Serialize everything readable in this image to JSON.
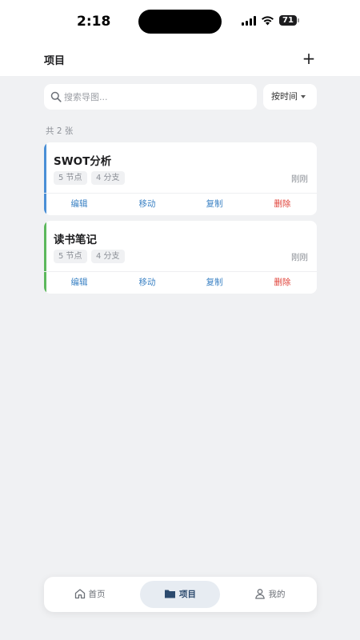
{
  "status_bar": {
    "time": "2:18",
    "battery": "71"
  },
  "header": {
    "title": "项目",
    "add_label": "+"
  },
  "search": {
    "placeholder": "搜索导图..."
  },
  "sort": {
    "label": "按时间"
  },
  "summary": {
    "count_text": "共 2 张"
  },
  "cards": [
    {
      "title": "SWOT分析",
      "tags": [
        "5 节点",
        "4 分支"
      ],
      "time": "刚刚",
      "accent_color": "#4a8fd6"
    },
    {
      "title": "读书笔记",
      "tags": [
        "5 节点",
        "4 分支"
      ],
      "time": "刚刚",
      "accent_color": "#5cb85c"
    }
  ],
  "card_actions": {
    "edit": "编辑",
    "move": "移动",
    "copy": "复制",
    "delete": "删除"
  },
  "colors": {
    "action_blue": "#3b82c4",
    "action_red": "#e0433a"
  },
  "tabbar": {
    "tabs": [
      {
        "label": "首页",
        "icon": "home-icon",
        "active": false
      },
      {
        "label": "项目",
        "icon": "folder-icon",
        "active": true
      },
      {
        "label": "我的",
        "icon": "user-icon",
        "active": false
      }
    ]
  }
}
